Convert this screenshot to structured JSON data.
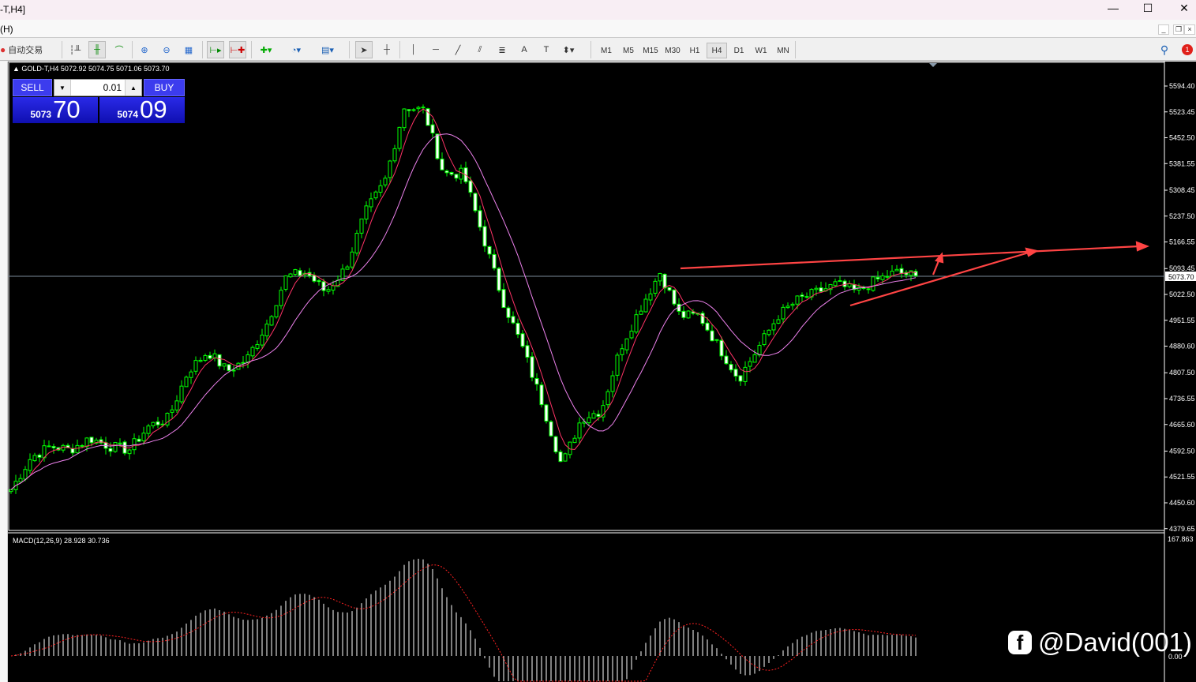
{
  "window": {
    "title": "-T,H4]",
    "menu": "(H)",
    "minimize": "—",
    "maximize": "☐",
    "close": "✕"
  },
  "toolbar": {
    "auto_trade": "自动交易",
    "text_tool": "A",
    "textlabel_tool": "T",
    "timeframes": [
      "M1",
      "M5",
      "M15",
      "M30",
      "H1",
      "H4",
      "D1",
      "W1",
      "MN"
    ],
    "active_timeframe": "H4",
    "notifications": "1"
  },
  "chart": {
    "info": "GOLD-T,H4  5072.92 5074.75 5071.06 5073.70",
    "sell_label": "SELL",
    "buy_label": "BUY",
    "lot": "0.01",
    "sell_big": "5073",
    "sell_small": "70",
    "buy_big": "5074",
    "buy_small": "09",
    "current_price": "5073.70",
    "price_ticks": [
      "5594.40",
      "5523.45",
      "5452.50",
      "5381.55",
      "5308.45",
      "5237.50",
      "5166.55",
      "5093.45",
      "5022.50",
      "4951.55",
      "4880.60",
      "4807.50",
      "4736.55",
      "4665.60",
      "4592.50",
      "4521.55",
      "4450.60",
      "4379.65"
    ],
    "macd_label": "MACD(12,26,9) 28.928 30.736",
    "macd_max": "167.863",
    "macd_zero": "0.00",
    "watermark": "@David(001)"
  },
  "chart_data": {
    "type": "candlestick",
    "symbol": "GOLD-T",
    "timeframe": "H4",
    "ylim": [
      4379.65,
      5630
    ],
    "close_waypoints": [
      4487,
      4574,
      4606,
      4596,
      4628,
      4606,
      4596,
      4661,
      4683,
      4812,
      4866,
      4812,
      4845,
      4942,
      5072,
      5083,
      5029,
      5094,
      5246,
      5332,
      5538,
      5527,
      5354,
      5354,
      5181,
      5007,
      4877,
      4726,
      4552,
      4683,
      4704,
      4877,
      4986,
      5083,
      4964,
      4964,
      4877,
      4791,
      4877,
      4964,
      5007,
      5029,
      5051,
      5029,
      5062,
      5083,
      5073.7
    ],
    "colors": {
      "bull": "#00ff00",
      "bear": "#ffffff",
      "ma_fast": "#ff3366",
      "ma_slow": "#ee82ee",
      "macd_signal": "#ff2020",
      "trendline": "#ff4040"
    }
  }
}
